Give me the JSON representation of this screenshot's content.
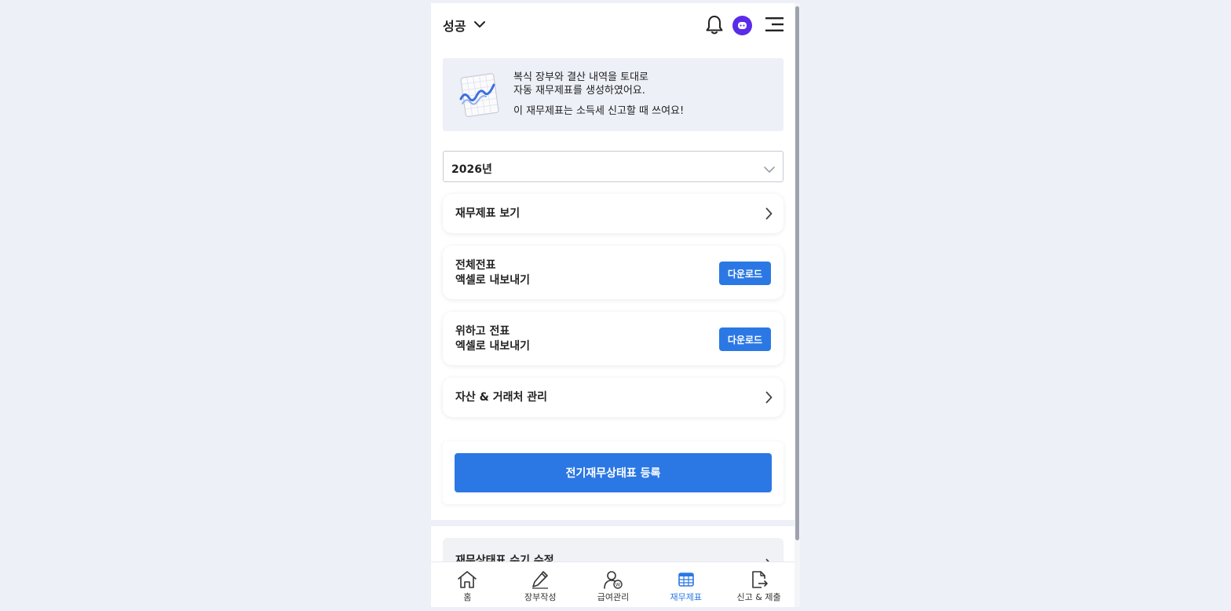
{
  "header": {
    "business_name": "성공",
    "icons": [
      "chevron-down-icon",
      "bell-icon",
      "avatar",
      "hamburger-menu-icon"
    ],
    "avatar_color": "#5b2bea"
  },
  "banner": {
    "line1": "복식 장부와 결산 내역을 토대로",
    "line2": "자동 재무제표를 생성하였어요.",
    "line3": "이 재무제표는 소득세 신고할 때 쓰여요!"
  },
  "year_select": {
    "value": "2026년"
  },
  "cards": {
    "view_statements": {
      "label": "재무제표 보기"
    },
    "all_vouchers": {
      "line1": "전체전표",
      "line2": "액셀로 내보내기",
      "button": "다운로드"
    },
    "wihago_vouchers": {
      "line1": "위하고 전표",
      "line2": "엑셀로 내보내기",
      "button": "다운로드"
    },
    "assets_partners": {
      "label": "자산 & 거래처 관리"
    }
  },
  "register": {
    "label": "전기재무상태표 등록"
  },
  "manual_edit": {
    "label": "재무상태표 수기 수정"
  },
  "tabbar": {
    "tabs": [
      {
        "label": "홈",
        "icon": "home-icon",
        "active": false
      },
      {
        "label": "장부작성",
        "icon": "pencil-icon",
        "active": false
      },
      {
        "label": "급여관리",
        "icon": "payroll-user-icon",
        "active": false
      },
      {
        "label": "재무제표",
        "icon": "table-icon",
        "active": true
      },
      {
        "label": "신고 & 제출",
        "icon": "file-export-icon",
        "active": false
      }
    ]
  },
  "colors": {
    "accent": "#2b78e4",
    "page_background": "#eef0f8",
    "banner_background": "#eef0f8"
  }
}
